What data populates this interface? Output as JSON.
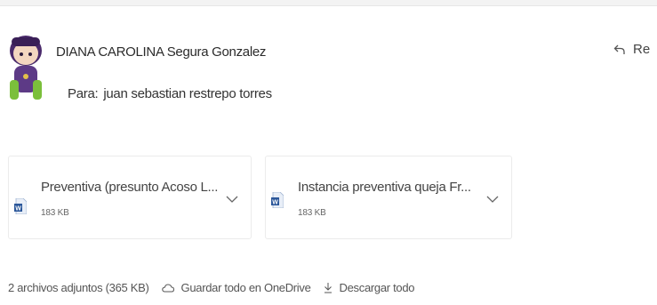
{
  "message": {
    "sender": "DIANA CAROLINA Segura Gonzalez",
    "to_label": "Para:",
    "recipient": "juan sebastian restrepo torres",
    "reply_label": "Re"
  },
  "attachments": [
    {
      "name": "Preventiva (presunto Acoso L...",
      "size": "183 KB",
      "icon": "word-doc-icon"
    },
    {
      "name": "Instancia preventiva queja Fr...",
      "size": "183 KB",
      "icon": "word-doc-icon"
    }
  ],
  "footer": {
    "summary": "2 archivos adjuntos (365 KB)",
    "save_onedrive": "Guardar todo en OneDrive",
    "download_all": "Descargar todo"
  },
  "colors": {
    "word_blue": "#2b579a",
    "accent": "#0f6cbd"
  }
}
